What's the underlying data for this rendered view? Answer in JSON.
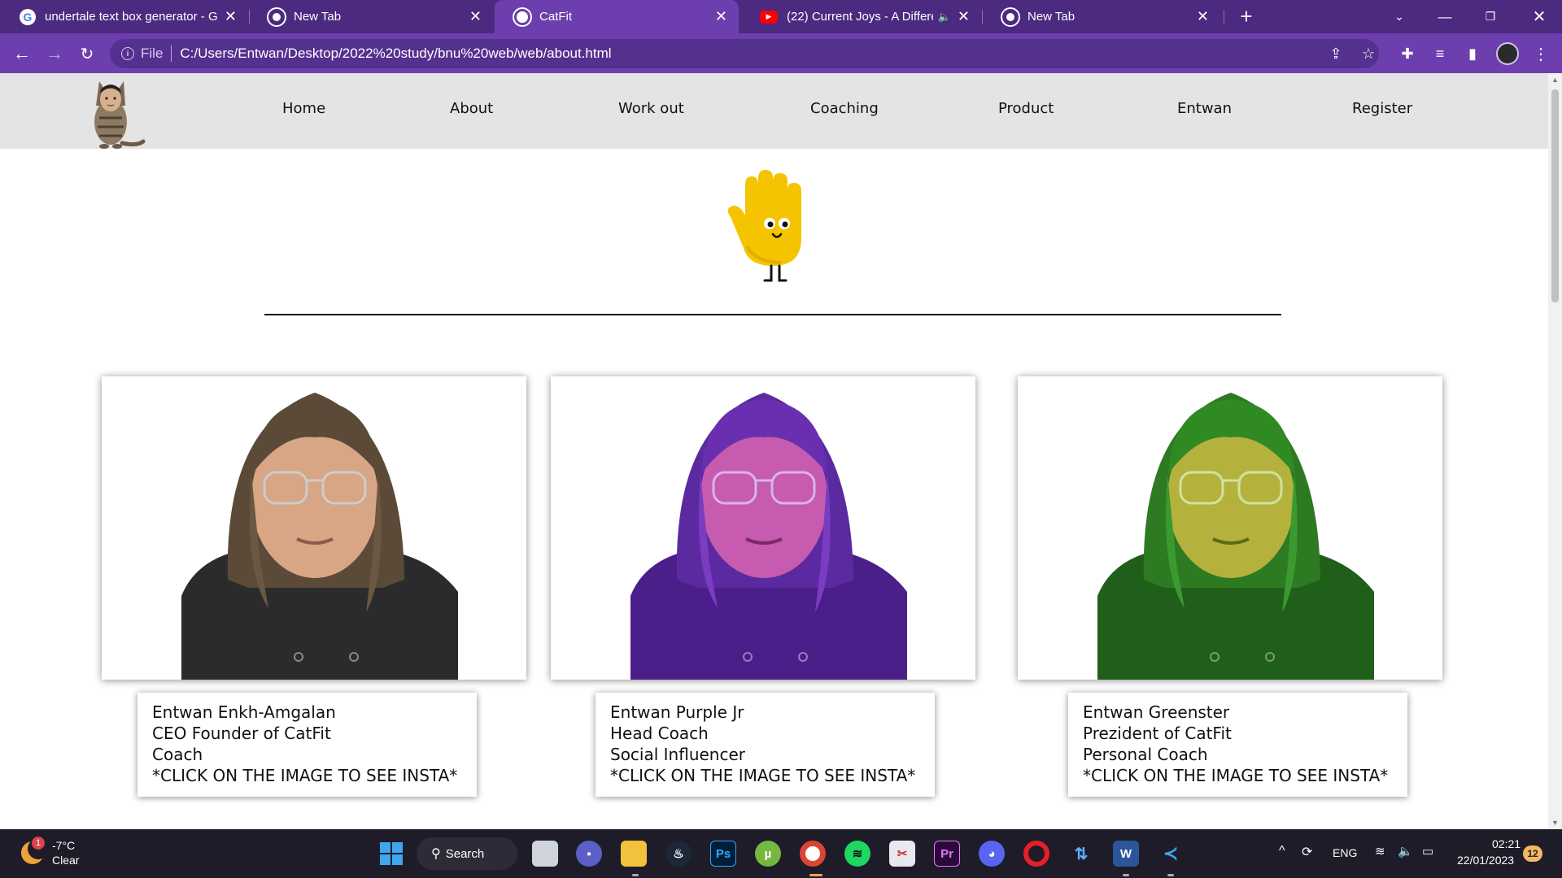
{
  "browser": {
    "tabs": [
      {
        "title": "undertale text box generator - G",
        "icon": "google-icon",
        "active": false
      },
      {
        "title": "New Tab",
        "icon": "chrome-icon",
        "active": false
      },
      {
        "title": "CatFit",
        "icon": "globe-icon",
        "active": true
      },
      {
        "title": "(22) Current Joys - A Differen",
        "icon": "youtube-icon",
        "active": false
      },
      {
        "title": "New Tab",
        "icon": "chrome-icon",
        "active": false
      }
    ],
    "new_tab_glyph": "+",
    "close_glyph": "✕",
    "address": {
      "scheme_label": "File",
      "url": "C:/Users/Entwan/Desktop/2022%20study/bnu%20web/web/about.html"
    },
    "colors": {
      "frame": "#4b2a80",
      "toolbar": "#6d3fae",
      "omnibox": "#54308f"
    }
  },
  "site": {
    "nav": [
      "Home",
      "About",
      "Work out",
      "Coaching",
      "Product",
      "Entwan",
      "Register"
    ],
    "cards": [
      {
        "tint": "natural",
        "lines": [
          "Entwan Enkh-Amgalan",
          "CEO Founder of CatFit",
          "Coach",
          "*CLICK ON THE IMAGE TO SEE INSTA*"
        ]
      },
      {
        "tint": "purple",
        "lines": [
          "Entwan Purple Jr",
          "Head Coach",
          "Social Influencer",
          "*CLICK ON THE IMAGE TO SEE INSTA*"
        ]
      },
      {
        "tint": "green",
        "lines": [
          "Entwan Greenster",
          "Prezident of CatFit",
          "Personal Coach",
          "*CLICK ON THE IMAGE TO SEE INSTA*"
        ]
      }
    ],
    "header_bg": "#e4e4e4"
  },
  "taskbar": {
    "weather": {
      "temp": "-7°C",
      "condition": "Clear",
      "badge": "1"
    },
    "search_label": "Search",
    "tray": {
      "language": "ENG",
      "time": "02:21",
      "date": "22/01/2023",
      "notifications": "12"
    }
  }
}
